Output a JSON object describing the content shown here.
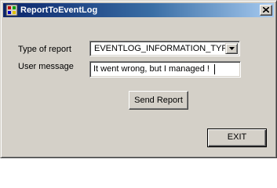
{
  "window": {
    "title": "ReportToEventLog",
    "icon": "app-icon",
    "close_icon": "close-icon"
  },
  "form": {
    "type_label": "Type of report",
    "type_value": "EVENTLOG_INFORMATION_TYPE",
    "dropdown_icon": "chevron-down-icon",
    "message_label": "User message",
    "message_value": "It went wrong, but I managed !"
  },
  "buttons": {
    "send_label": "Send Report",
    "exit_label": "EXIT"
  }
}
